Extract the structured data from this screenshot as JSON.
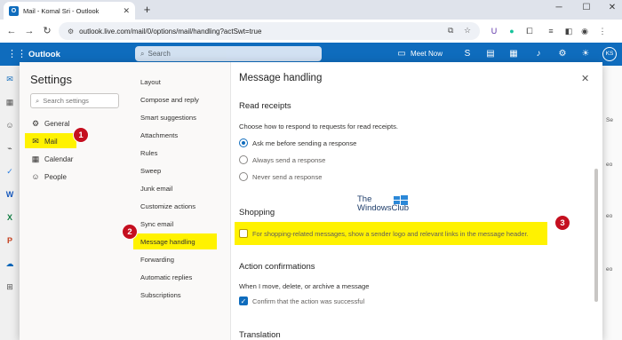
{
  "browser": {
    "tab_title": "Mail - Komal Sri - Outlook",
    "url": "outlook.live.com/mail/0/options/mail/handling?actSwt=true"
  },
  "outlook": {
    "brand": "Outlook",
    "search_placeholder": "Search",
    "meet_now": "Meet Now",
    "avatar_initials": "KS"
  },
  "settings": {
    "title": "Settings",
    "search_placeholder": "Search settings",
    "categories": [
      {
        "label": "General",
        "icon": "gear-icon"
      },
      {
        "label": "Mail",
        "icon": "mail-icon"
      },
      {
        "label": "Calendar",
        "icon": "calendar-icon"
      },
      {
        "label": "People",
        "icon": "people-icon"
      }
    ],
    "subcategories": [
      "Layout",
      "Compose and reply",
      "Smart suggestions",
      "Attachments",
      "Rules",
      "Sweep",
      "Junk email",
      "Customize actions",
      "Sync email",
      "Message handling",
      "Forwarding",
      "Automatic replies",
      "Subscriptions"
    ]
  },
  "content": {
    "title": "Message handling",
    "read_receipts": {
      "heading": "Read receipts",
      "description": "Choose how to respond to requests for read receipts.",
      "options": [
        "Ask me before sending a response",
        "Always send a response",
        "Never send a response"
      ],
      "selected": "Ask me before sending a response"
    },
    "shopping": {
      "heading": "Shopping",
      "checkbox_label": "For shopping-related messages, show a sender logo and relevant links in the message header.",
      "checked": false
    },
    "action_confirmations": {
      "heading": "Action confirmations",
      "description": "When I move, delete, or archive a message",
      "checkbox_label": "Confirm that the action was successful",
      "checked": true
    },
    "translation": {
      "heading": "Translation"
    }
  },
  "annotations": {
    "badge_1": "1",
    "badge_2": "2",
    "badge_3": "3",
    "highlight_color": "#fff200",
    "badge_color": "#c50f1f"
  },
  "watermark": {
    "line1": "The",
    "line2": "WindowsClub"
  },
  "right_pane_snippets": [
    "Se",
    "eo",
    "eo",
    "eo"
  ]
}
